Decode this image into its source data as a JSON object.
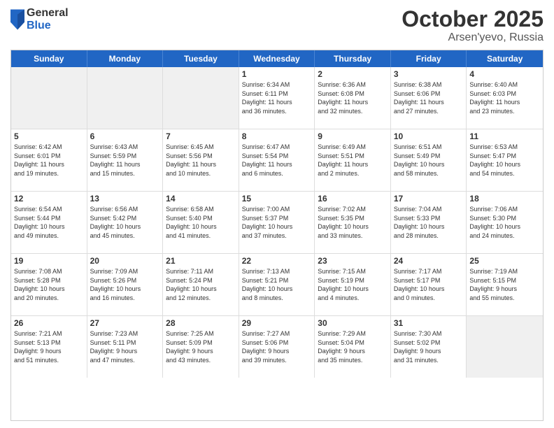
{
  "logo": {
    "general": "General",
    "blue": "Blue"
  },
  "header": {
    "month": "October 2025",
    "location": "Arsen'yevo, Russia"
  },
  "weekdays": [
    "Sunday",
    "Monday",
    "Tuesday",
    "Wednesday",
    "Thursday",
    "Friday",
    "Saturday"
  ],
  "weeks": [
    [
      {
        "day": "",
        "info": "",
        "shaded": true
      },
      {
        "day": "",
        "info": "",
        "shaded": true
      },
      {
        "day": "",
        "info": "",
        "shaded": true
      },
      {
        "day": "1",
        "info": "Sunrise: 6:34 AM\nSunset: 6:11 PM\nDaylight: 11 hours\nand 36 minutes."
      },
      {
        "day": "2",
        "info": "Sunrise: 6:36 AM\nSunset: 6:08 PM\nDaylight: 11 hours\nand 32 minutes."
      },
      {
        "day": "3",
        "info": "Sunrise: 6:38 AM\nSunset: 6:06 PM\nDaylight: 11 hours\nand 27 minutes."
      },
      {
        "day": "4",
        "info": "Sunrise: 6:40 AM\nSunset: 6:03 PM\nDaylight: 11 hours\nand 23 minutes."
      }
    ],
    [
      {
        "day": "5",
        "info": "Sunrise: 6:42 AM\nSunset: 6:01 PM\nDaylight: 11 hours\nand 19 minutes."
      },
      {
        "day": "6",
        "info": "Sunrise: 6:43 AM\nSunset: 5:59 PM\nDaylight: 11 hours\nand 15 minutes."
      },
      {
        "day": "7",
        "info": "Sunrise: 6:45 AM\nSunset: 5:56 PM\nDaylight: 11 hours\nand 10 minutes."
      },
      {
        "day": "8",
        "info": "Sunrise: 6:47 AM\nSunset: 5:54 PM\nDaylight: 11 hours\nand 6 minutes."
      },
      {
        "day": "9",
        "info": "Sunrise: 6:49 AM\nSunset: 5:51 PM\nDaylight: 11 hours\nand 2 minutes."
      },
      {
        "day": "10",
        "info": "Sunrise: 6:51 AM\nSunset: 5:49 PM\nDaylight: 10 hours\nand 58 minutes."
      },
      {
        "day": "11",
        "info": "Sunrise: 6:53 AM\nSunset: 5:47 PM\nDaylight: 10 hours\nand 54 minutes."
      }
    ],
    [
      {
        "day": "12",
        "info": "Sunrise: 6:54 AM\nSunset: 5:44 PM\nDaylight: 10 hours\nand 49 minutes."
      },
      {
        "day": "13",
        "info": "Sunrise: 6:56 AM\nSunset: 5:42 PM\nDaylight: 10 hours\nand 45 minutes."
      },
      {
        "day": "14",
        "info": "Sunrise: 6:58 AM\nSunset: 5:40 PM\nDaylight: 10 hours\nand 41 minutes."
      },
      {
        "day": "15",
        "info": "Sunrise: 7:00 AM\nSunset: 5:37 PM\nDaylight: 10 hours\nand 37 minutes."
      },
      {
        "day": "16",
        "info": "Sunrise: 7:02 AM\nSunset: 5:35 PM\nDaylight: 10 hours\nand 33 minutes."
      },
      {
        "day": "17",
        "info": "Sunrise: 7:04 AM\nSunset: 5:33 PM\nDaylight: 10 hours\nand 28 minutes."
      },
      {
        "day": "18",
        "info": "Sunrise: 7:06 AM\nSunset: 5:30 PM\nDaylight: 10 hours\nand 24 minutes."
      }
    ],
    [
      {
        "day": "19",
        "info": "Sunrise: 7:08 AM\nSunset: 5:28 PM\nDaylight: 10 hours\nand 20 minutes."
      },
      {
        "day": "20",
        "info": "Sunrise: 7:09 AM\nSunset: 5:26 PM\nDaylight: 10 hours\nand 16 minutes."
      },
      {
        "day": "21",
        "info": "Sunrise: 7:11 AM\nSunset: 5:24 PM\nDaylight: 10 hours\nand 12 minutes."
      },
      {
        "day": "22",
        "info": "Sunrise: 7:13 AM\nSunset: 5:21 PM\nDaylight: 10 hours\nand 8 minutes."
      },
      {
        "day": "23",
        "info": "Sunrise: 7:15 AM\nSunset: 5:19 PM\nDaylight: 10 hours\nand 4 minutes."
      },
      {
        "day": "24",
        "info": "Sunrise: 7:17 AM\nSunset: 5:17 PM\nDaylight: 10 hours\nand 0 minutes."
      },
      {
        "day": "25",
        "info": "Sunrise: 7:19 AM\nSunset: 5:15 PM\nDaylight: 9 hours\nand 55 minutes."
      }
    ],
    [
      {
        "day": "26",
        "info": "Sunrise: 7:21 AM\nSunset: 5:13 PM\nDaylight: 9 hours\nand 51 minutes."
      },
      {
        "day": "27",
        "info": "Sunrise: 7:23 AM\nSunset: 5:11 PM\nDaylight: 9 hours\nand 47 minutes."
      },
      {
        "day": "28",
        "info": "Sunrise: 7:25 AM\nSunset: 5:09 PM\nDaylight: 9 hours\nand 43 minutes."
      },
      {
        "day": "29",
        "info": "Sunrise: 7:27 AM\nSunset: 5:06 PM\nDaylight: 9 hours\nand 39 minutes."
      },
      {
        "day": "30",
        "info": "Sunrise: 7:29 AM\nSunset: 5:04 PM\nDaylight: 9 hours\nand 35 minutes."
      },
      {
        "day": "31",
        "info": "Sunrise: 7:30 AM\nSunset: 5:02 PM\nDaylight: 9 hours\nand 31 minutes."
      },
      {
        "day": "",
        "info": "",
        "shaded": true
      }
    ]
  ]
}
